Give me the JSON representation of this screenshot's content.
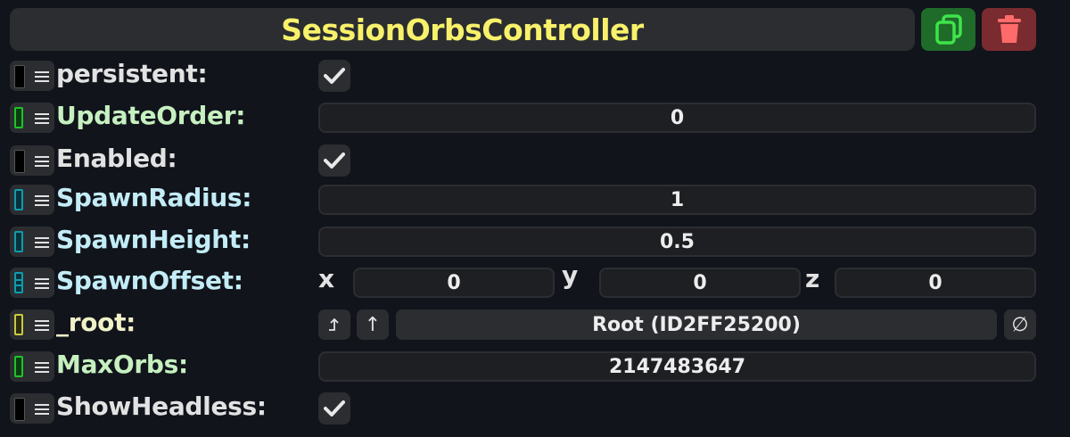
{
  "header": {
    "title": "SessionOrbsController",
    "duplicate_icon": "duplicate-icon",
    "delete_icon": "trash-icon",
    "colors": {
      "title": "#f8f16a",
      "duplicate_bg": "#1f6b2a",
      "delete_bg": "#7a2b2f"
    }
  },
  "fields": {
    "persistent": {
      "label": "persistent:",
      "checked": true,
      "handle_color": "#000000"
    },
    "update_order": {
      "label": "UpdateOrder:",
      "value": "0",
      "handle_color": "#1fc32a"
    },
    "enabled": {
      "label": "Enabled:",
      "checked": true,
      "handle_color": "#000000"
    },
    "spawn_radius": {
      "label": "SpawnRadius:",
      "value": "1",
      "handle_color": "#0f7d8d"
    },
    "spawn_height": {
      "label": "SpawnHeight:",
      "value": "0.5",
      "handle_color": "#0f7d8d"
    },
    "spawn_offset": {
      "label": "SpawnOffset:",
      "x_label": "x",
      "x_value": "0",
      "y_label": "y",
      "y_value": "0",
      "z_label": "z",
      "z_value": "0",
      "handle_color": "#0f7d8d"
    },
    "root": {
      "label": "_root:",
      "value": "Root (ID2FF25200)",
      "open_button": "⮥",
      "parent_button": "↑",
      "clear_button": "∅",
      "handle_color": "#c9c940"
    },
    "max_orbs": {
      "label": "MaxOrbs:",
      "value": "2147483647",
      "handle_color": "#1fc32a"
    },
    "show_headless": {
      "label": "ShowHeadless:",
      "checked": true,
      "handle_color": "#000000"
    }
  }
}
